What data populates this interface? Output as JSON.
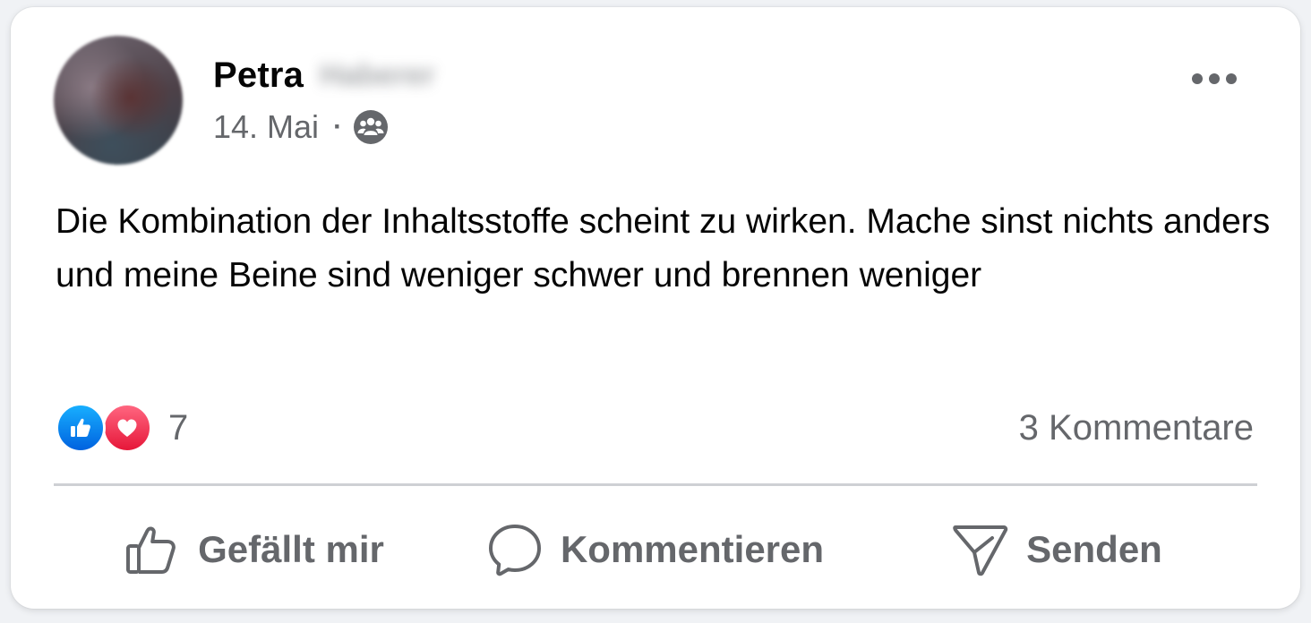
{
  "post": {
    "author": {
      "first_name": "Petra",
      "last_name_obscured": "Haberer"
    },
    "date": "14. Mai",
    "separator": "·",
    "audience_icon": "group-icon",
    "more_icon": "more-options-icon",
    "text": "Die Kombination der Inhaltsstoffe scheint zu wirken. Mache sinst nichts anders und meine Beine sind weniger schwer und brennen weniger",
    "reactions": {
      "types": [
        "like",
        "love"
      ],
      "count": "7"
    },
    "comments_count_label": "3 Kommentare"
  },
  "actions": {
    "like_label": "Gefällt mir",
    "comment_label": "Kommentieren",
    "send_label": "Senden"
  },
  "colors": {
    "text_primary": "#050505",
    "text_secondary": "#65676b",
    "like_blue": "#1877f2",
    "love_red": "#f33e58",
    "divider": "#ced0d4"
  }
}
